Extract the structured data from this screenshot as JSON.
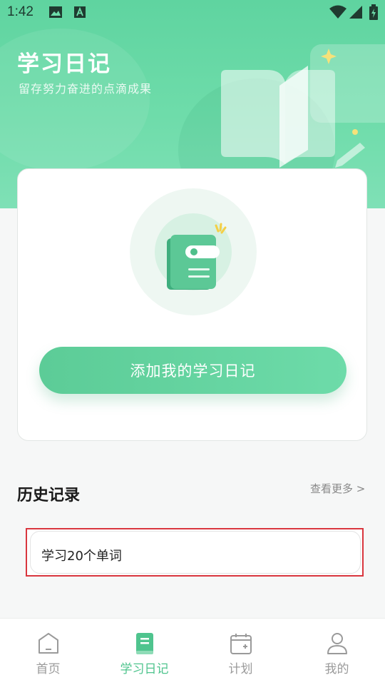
{
  "status_bar": {
    "time": "1:42"
  },
  "hero": {
    "title": "学习日记",
    "subtitle": "留存努力奋进的点滴成果"
  },
  "card": {
    "add_button_label": "添加我的学习日记"
  },
  "history": {
    "title": "历史记录",
    "more_label": "查看更多 >",
    "records": [
      {
        "label": "学习20个单词"
      }
    ]
  },
  "tabs": [
    {
      "label": "首页",
      "icon": "home-icon",
      "active": false
    },
    {
      "label": "学习日记",
      "icon": "diary-book-icon",
      "active": true
    },
    {
      "label": "计划",
      "icon": "calendar-icon",
      "active": false
    },
    {
      "label": "我的",
      "icon": "profile-icon",
      "active": false
    }
  ],
  "colors": {
    "accent": "#4fc48e",
    "hero": "#5fd4a0",
    "highlight": "#d9363e"
  }
}
